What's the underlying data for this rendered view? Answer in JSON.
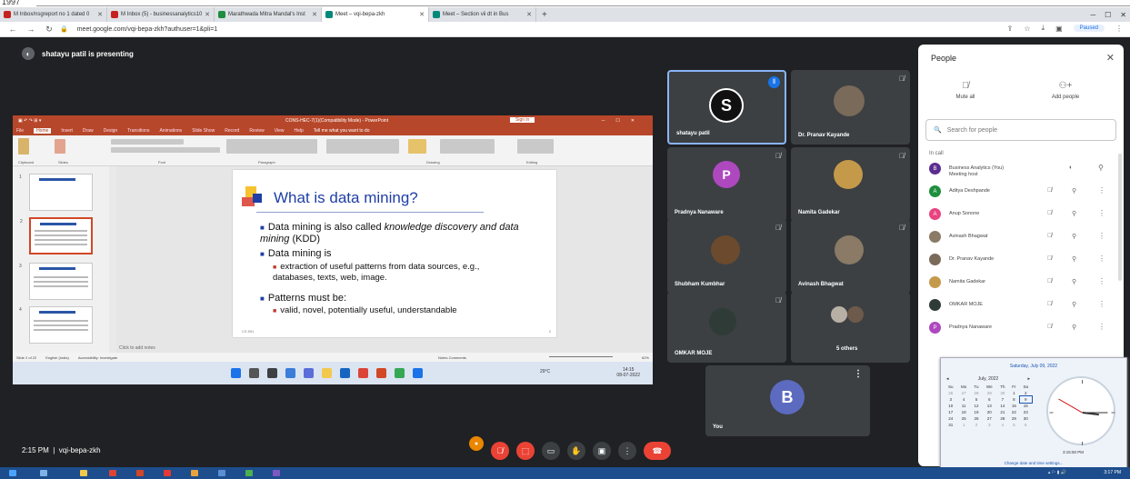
{
  "top_number": "1997",
  "browser": {
    "tabs": [
      {
        "label": "M Inbox/nsgreport no 1 dated 0",
        "color": "#c5221f"
      },
      {
        "label": "M Inbox (5) - businessanalytics10",
        "color": "#c5221f"
      },
      {
        "label": "Marathwada Mitra Mandal's Inst",
        "color": "#1e8e3e"
      },
      {
        "label": "Meet – vqi-bepa-zkh",
        "color": "#00897b",
        "active": true
      },
      {
        "label": "Meet – Section vii dt in Bus",
        "color": "#00897b"
      }
    ],
    "new_tab": "+",
    "url": "meet.google.com/vqi-bepa-zkh?authuser=1&pli=1",
    "paused_label": "Paused"
  },
  "meet": {
    "presenting_text": "shatayu patil is presenting",
    "meeting_time": "2:15 PM",
    "meeting_code": "vqi-bepa-zkh",
    "tiles": [
      {
        "name": "shatayu patil",
        "initial": "S",
        "avatar_color": "#111111",
        "speaking": true
      },
      {
        "name": "Dr. Pranav Kayande",
        "avatar_color": "#7a6a5a"
      },
      {
        "name": "Pradnya Nanaware",
        "initial": "P",
        "avatar_color": "#ad48be"
      },
      {
        "name": "Namita Gadekar",
        "avatar_color": "#c49a4a"
      },
      {
        "name": "Shubham Kumbhar",
        "avatar_color": "#6b4a2e"
      },
      {
        "name": "Avinash Bhagwat",
        "avatar_color": "#8a7a66"
      },
      {
        "name": "OMKAR MOJE",
        "avatar_color": "#2f3b37"
      },
      {
        "name": "5 others",
        "avatar_color": "#b8b0a5"
      },
      {
        "name": "You",
        "initial": "B",
        "avatar_color": "#5c6bc0"
      }
    ]
  },
  "ppt": {
    "window_title": "CONS-HEC-7(1)(Compatibility Mode) - PowerPoint",
    "sign_in": "Sign in",
    "menu": [
      "File",
      "Home",
      "Insert",
      "Draw",
      "Design",
      "Transitions",
      "Animations",
      "Slide Show",
      "Record",
      "Review",
      "View",
      "Help",
      "Tell me what you want to do"
    ],
    "ribbon_groups": [
      "Clipboard",
      "Slides",
      "Font",
      "Paragraph",
      "Drawing",
      "Editing"
    ],
    "slide": {
      "title": "What is data mining?",
      "b1_pre": "Data mining is also called ",
      "b1_em": "knowledge discovery and data mining",
      "b1_post": " (KDD)",
      "b2": "Data mining is",
      "s1": "extraction of useful patterns from data sources, e.g., databases, texts, web, image.",
      "b3": "Patterns must be:",
      "s2": "valid, novel, potentially useful, understandable",
      "footer": "CS 591",
      "page": "2"
    },
    "notes_placeholder": "Click to add notes",
    "status_left": "Slide 2 of 22",
    "status_lang": "English (India)",
    "status_access": "Accessibility: Investigate",
    "status_notes": "Notes",
    "status_comments": "Comments",
    "status_zoom": "62%",
    "taskbar_time": "14:15",
    "taskbar_date": "08-07-2022",
    "taskbar_weather": "29°C"
  },
  "people": {
    "title": "People",
    "mute_all": "Mute all",
    "add_people": "Add people",
    "search_placeholder": "Search for people",
    "in_call": "In call",
    "list": [
      {
        "name": "Business Analytics (You)",
        "sub": "Meeting host",
        "initial": "B",
        "color": "#5c2d91"
      },
      {
        "name": "Aditya Deshpande",
        "initial": "A",
        "color": "#1e8e3e"
      },
      {
        "name": "Anup Sonone",
        "initial": "A",
        "color": "#e8447f"
      },
      {
        "name": "Avinash Bhagwat",
        "initial": "",
        "color": "#8a7a66"
      },
      {
        "name": "Dr. Pranav Kayande",
        "initial": "",
        "color": "#7a6a5a"
      },
      {
        "name": "Namita Gadekar",
        "initial": "",
        "color": "#c49a4a"
      },
      {
        "name": "OMKAR MOJE",
        "initial": "",
        "color": "#2f3b37"
      },
      {
        "name": "Pradnya Nanaware",
        "initial": "P",
        "color": "#ad48be"
      }
    ]
  },
  "calendar": {
    "full_date": "Saturday, July 09, 2022",
    "month": "July, 2022",
    "dow": [
      "Su",
      "Mo",
      "Tu",
      "We",
      "Th",
      "Fr",
      "Sa"
    ],
    "weeks": [
      [
        "26",
        "27",
        "28",
        "29",
        "30",
        "1",
        "2"
      ],
      [
        "3",
        "4",
        "5",
        "6",
        "7",
        "8",
        "9"
      ],
      [
        "10",
        "11",
        "12",
        "13",
        "14",
        "15",
        "16"
      ],
      [
        "17",
        "18",
        "19",
        "20",
        "21",
        "22",
        "23"
      ],
      [
        "24",
        "25",
        "26",
        "27",
        "28",
        "29",
        "30"
      ],
      [
        "31",
        "1",
        "2",
        "3",
        "4",
        "5",
        "6"
      ]
    ],
    "time": "3:15:50 PM",
    "link": "Change date and time settings..."
  },
  "windows": {
    "clock": "3:17 PM"
  }
}
